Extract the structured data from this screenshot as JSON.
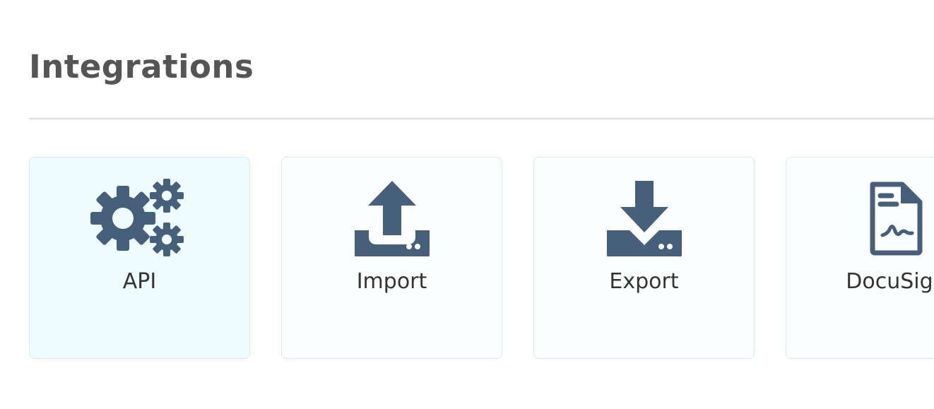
{
  "page": {
    "title": "Integrations"
  },
  "colors": {
    "icon": "#465f7a",
    "card_border": "#d6eaf0",
    "card_active_bg": "#effcfd",
    "card_bg": "#fbfdfe",
    "title": "#555555",
    "divider": "#dddddd"
  },
  "integrations": [
    {
      "label": "API",
      "icon": "gears-icon",
      "active": true
    },
    {
      "label": "Import",
      "icon": "upload-tray-icon",
      "active": false
    },
    {
      "label": "Export",
      "icon": "download-tray-icon",
      "active": false
    },
    {
      "label": "DocuSign",
      "icon": "signed-document-icon",
      "active": false
    }
  ]
}
